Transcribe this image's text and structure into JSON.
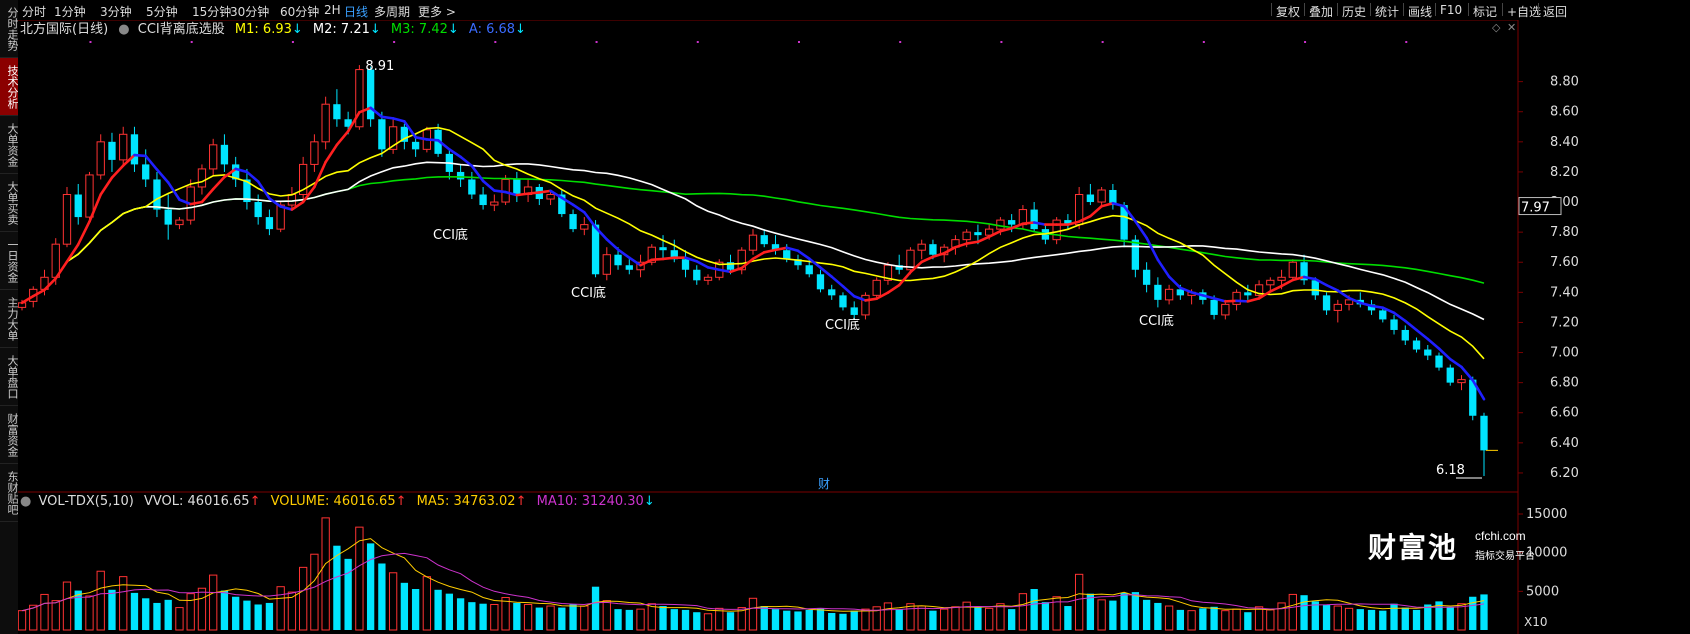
{
  "sidebar": {
    "items": [
      {
        "label": "分时走势",
        "active": false
      },
      {
        "label": "技术分析",
        "active": true
      },
      {
        "label": "大单资金",
        "active": false
      },
      {
        "label": "大单买卖",
        "active": false
      },
      {
        "label": "一日资金",
        "active": false
      },
      {
        "label": "主力大单",
        "active": false
      },
      {
        "label": "大单盘口",
        "active": false
      },
      {
        "label": "财富资金",
        "active": false
      },
      {
        "label": "东财贴吧",
        "active": false
      }
    ]
  },
  "toolbar": {
    "periods": [
      {
        "label": "分时",
        "active": false
      },
      {
        "label": "1分钟",
        "active": false
      },
      {
        "label": "3分钟",
        "active": false
      },
      {
        "label": "5分钟",
        "active": false
      },
      {
        "label": "15分钟",
        "active": false
      },
      {
        "label": "30分钟",
        "active": false
      },
      {
        "label": "60分钟",
        "active": false
      },
      {
        "label": "2H",
        "active": false
      },
      {
        "label": "日线",
        "active": true
      },
      {
        "label": "多周期",
        "active": false
      },
      {
        "label": "更多 >",
        "active": false
      }
    ],
    "right": [
      "复权",
      "叠加",
      "历史",
      "统计",
      "画线",
      "F10",
      "标记",
      "+自选",
      "返回"
    ]
  },
  "price_panel": {
    "stock": "北方国际(日线)",
    "indicator": "CCI背离底选股",
    "m1": "M1: 6.93",
    "m1_arrow": "↓",
    "m2": "M2: 7.21",
    "m2_arrow": "↓",
    "m3": "M3: 7.42",
    "m3_arrow": "↓",
    "a": "A: 6.68",
    "a_arrow": "↓",
    "colors": {
      "m1": "#ffff00",
      "m2": "#ffffff",
      "m3": "#00dd00",
      "a": "#2020ff",
      "up": "#ff3333",
      "down": "#00e5ff"
    }
  },
  "volume_panel": {
    "indicator": "VOL-TDX(5,10)",
    "vvol": "VVOL: 46016.65",
    "vvol_arrow": "↑",
    "volume": "VOLUME: 46016.65",
    "volume_arrow": "↑",
    "ma5": "MA5: 34763.02",
    "ma5_arrow": "↑",
    "ma10": "MA10: 31240.30",
    "ma10_arrow": "↓",
    "unit": "X10"
  },
  "watermark": {
    "main": "财富池",
    "url": "cfchi.com",
    "sub": "指标交易平台"
  },
  "chart_data": {
    "type": "candlestick",
    "price_axis": {
      "ylim": [
        6.1,
        9.05
      ],
      "ticks": [
        "8.80",
        "8.60",
        "8.40",
        "8.20",
        "8.00",
        "7.80",
        "7.60",
        "7.40",
        "7.20",
        "7.00",
        "6.80",
        "6.60",
        "6.40",
        "6.20"
      ],
      "current": "7.97"
    },
    "volume_axis": {
      "ylim": [
        0,
        15000
      ],
      "ticks": [
        "15000",
        "10000",
        "5000"
      ]
    },
    "ohlc": [
      [
        7.3,
        7.35,
        7.28,
        7.33
      ],
      [
        7.34,
        7.44,
        7.3,
        7.42
      ],
      [
        7.42,
        7.55,
        7.38,
        7.5
      ],
      [
        7.5,
        7.76,
        7.45,
        7.72
      ],
      [
        7.72,
        8.1,
        7.7,
        8.05
      ],
      [
        8.05,
        8.12,
        7.85,
        7.9
      ],
      [
        7.9,
        8.2,
        7.88,
        8.18
      ],
      [
        8.18,
        8.45,
        8.15,
        8.4
      ],
      [
        8.4,
        8.46,
        8.2,
        8.28
      ],
      [
        8.28,
        8.5,
        8.25,
        8.45
      ],
      [
        8.45,
        8.5,
        8.2,
        8.25
      ],
      [
        8.25,
        8.35,
        8.1,
        8.15
      ],
      [
        8.15,
        8.2,
        7.9,
        7.95
      ],
      [
        7.95,
        8.05,
        7.75,
        7.85
      ],
      [
        7.85,
        7.9,
        7.82,
        7.88
      ],
      [
        7.88,
        8.15,
        7.85,
        8.1
      ],
      [
        8.1,
        8.25,
        8.05,
        8.22
      ],
      [
        8.22,
        8.42,
        8.18,
        8.38
      ],
      [
        8.38,
        8.45,
        8.2,
        8.25
      ],
      [
        8.25,
        8.3,
        8.1,
        8.15
      ],
      [
        8.15,
        8.22,
        7.95,
        8.0
      ],
      [
        8.0,
        8.05,
        7.85,
        7.9
      ],
      [
        7.9,
        7.95,
        7.78,
        7.82
      ],
      [
        7.82,
        8.0,
        7.8,
        7.98
      ],
      [
        7.98,
        8.1,
        7.95,
        8.05
      ],
      [
        8.05,
        8.3,
        8.0,
        8.25
      ],
      [
        8.25,
        8.45,
        8.2,
        8.4
      ],
      [
        8.4,
        8.7,
        8.35,
        8.65
      ],
      [
        8.65,
        8.75,
        8.5,
        8.55
      ],
      [
        8.55,
        8.6,
        8.45,
        8.5
      ],
      [
        8.5,
        8.91,
        8.48,
        8.88
      ],
      [
        8.88,
        8.9,
        8.5,
        8.55
      ],
      [
        8.55,
        8.6,
        8.3,
        8.35
      ],
      [
        8.35,
        8.55,
        8.32,
        8.5
      ],
      [
        8.5,
        8.52,
        8.35,
        8.4
      ],
      [
        8.4,
        8.45,
        8.3,
        8.35
      ],
      [
        8.35,
        8.5,
        8.33,
        8.48
      ],
      [
        8.48,
        8.52,
        8.3,
        8.32
      ],
      [
        8.32,
        8.35,
        8.15,
        8.2
      ],
      [
        8.2,
        8.25,
        8.1,
        8.15
      ],
      [
        8.15,
        8.2,
        8.02,
        8.05
      ],
      [
        8.05,
        8.1,
        7.95,
        7.98
      ],
      [
        7.98,
        8.05,
        7.94,
        8.0
      ],
      [
        8.0,
        8.18,
        7.98,
        8.15
      ],
      [
        8.15,
        8.2,
        8.0,
        8.05
      ],
      [
        8.05,
        8.15,
        8.0,
        8.1
      ],
      [
        8.1,
        8.12,
        7.98,
        8.02
      ],
      [
        8.02,
        8.08,
        7.98,
        8.05
      ],
      [
        8.05,
        8.08,
        7.9,
        7.92
      ],
      [
        7.92,
        7.95,
        7.8,
        7.82
      ],
      [
        7.82,
        7.9,
        7.78,
        7.85
      ],
      [
        7.85,
        7.88,
        7.5,
        7.52
      ],
      [
        7.52,
        7.7,
        7.48,
        7.65
      ],
      [
        7.65,
        7.7,
        7.55,
        7.58
      ],
      [
        7.58,
        7.62,
        7.52,
        7.55
      ],
      [
        7.55,
        7.65,
        7.5,
        7.6
      ],
      [
        7.6,
        7.72,
        7.58,
        7.7
      ],
      [
        7.7,
        7.78,
        7.62,
        7.68
      ],
      [
        7.68,
        7.75,
        7.6,
        7.62
      ],
      [
        7.62,
        7.68,
        7.5,
        7.55
      ],
      [
        7.55,
        7.58,
        7.45,
        7.48
      ],
      [
        7.48,
        7.52,
        7.45,
        7.5
      ],
      [
        7.5,
        7.62,
        7.48,
        7.6
      ],
      [
        7.6,
        7.65,
        7.52,
        7.55
      ],
      [
        7.55,
        7.7,
        7.52,
        7.68
      ],
      [
        7.68,
        7.82,
        7.65,
        7.78
      ],
      [
        7.78,
        7.82,
        7.7,
        7.72
      ],
      [
        7.72,
        7.78,
        7.65,
        7.68
      ],
      [
        7.68,
        7.72,
        7.6,
        7.62
      ],
      [
        7.62,
        7.65,
        7.55,
        7.58
      ],
      [
        7.58,
        7.62,
        7.5,
        7.52
      ],
      [
        7.52,
        7.55,
        7.4,
        7.42
      ],
      [
        7.42,
        7.45,
        7.35,
        7.38
      ],
      [
        7.38,
        7.4,
        7.28,
        7.3
      ],
      [
        7.3,
        7.34,
        7.22,
        7.25
      ],
      [
        7.25,
        7.4,
        7.22,
        7.38
      ],
      [
        7.38,
        7.5,
        7.35,
        7.48
      ],
      [
        7.48,
        7.6,
        7.45,
        7.58
      ],
      [
        7.58,
        7.65,
        7.52,
        7.55
      ],
      [
        7.55,
        7.7,
        7.52,
        7.68
      ],
      [
        7.68,
        7.75,
        7.62,
        7.72
      ],
      [
        7.72,
        7.75,
        7.62,
        7.65
      ],
      [
        7.65,
        7.72,
        7.6,
        7.7
      ],
      [
        7.7,
        7.78,
        7.65,
        7.75
      ],
      [
        7.75,
        7.82,
        7.7,
        7.8
      ],
      [
        7.8,
        7.85,
        7.72,
        7.78
      ],
      [
        7.78,
        7.85,
        7.75,
        7.82
      ],
      [
        7.82,
        7.9,
        7.78,
        7.88
      ],
      [
        7.88,
        7.92,
        7.8,
        7.85
      ],
      [
        7.85,
        7.98,
        7.82,
        7.95
      ],
      [
        7.95,
        8.0,
        7.8,
        7.82
      ],
      [
        7.82,
        7.85,
        7.72,
        7.75
      ],
      [
        7.75,
        7.9,
        7.72,
        7.88
      ],
      [
        7.88,
        7.92,
        7.82,
        7.85
      ],
      [
        7.85,
        8.1,
        7.82,
        8.05
      ],
      [
        8.05,
        8.12,
        7.98,
        8.0
      ],
      [
        8.0,
        8.1,
        7.98,
        8.08
      ],
      [
        8.08,
        8.12,
        7.95,
        7.98
      ],
      [
        7.98,
        8.0,
        7.7,
        7.75
      ],
      [
        7.75,
        7.78,
        7.5,
        7.55
      ],
      [
        7.55,
        7.6,
        7.4,
        7.45
      ],
      [
        7.45,
        7.5,
        7.3,
        7.35
      ],
      [
        7.35,
        7.45,
        7.32,
        7.42
      ],
      [
        7.42,
        7.45,
        7.35,
        7.38
      ],
      [
        7.38,
        7.42,
        7.32,
        7.4
      ],
      [
        7.4,
        7.42,
        7.32,
        7.35
      ],
      [
        7.35,
        7.38,
        7.22,
        7.25
      ],
      [
        7.25,
        7.35,
        7.22,
        7.32
      ],
      [
        7.32,
        7.42,
        7.28,
        7.4
      ],
      [
        7.4,
        7.45,
        7.35,
        7.38
      ],
      [
        7.38,
        7.48,
        7.35,
        7.45
      ],
      [
        7.45,
        7.5,
        7.4,
        7.48
      ],
      [
        7.48,
        7.55,
        7.42,
        7.5
      ],
      [
        7.5,
        7.62,
        7.48,
        7.6
      ],
      [
        7.6,
        7.65,
        7.45,
        7.48
      ],
      [
        7.48,
        7.5,
        7.35,
        7.38
      ],
      [
        7.38,
        7.4,
        7.25,
        7.28
      ],
      [
        7.28,
        7.35,
        7.2,
        7.32
      ],
      [
        7.32,
        7.38,
        7.28,
        7.35
      ],
      [
        7.35,
        7.4,
        7.3,
        7.32
      ],
      [
        7.32,
        7.35,
        7.25,
        7.28
      ],
      [
        7.28,
        7.3,
        7.2,
        7.22
      ],
      [
        7.22,
        7.25,
        7.12,
        7.15
      ],
      [
        7.15,
        7.18,
        7.05,
        7.08
      ],
      [
        7.08,
        7.1,
        7.0,
        7.02
      ],
      [
        7.02,
        7.05,
        6.95,
        6.98
      ],
      [
        6.98,
        7.0,
        6.88,
        6.9
      ],
      [
        6.9,
        6.92,
        6.78,
        6.8
      ],
      [
        6.8,
        6.85,
        6.75,
        6.82
      ],
      [
        6.82,
        6.84,
        6.55,
        6.58
      ],
      [
        6.58,
        6.6,
        6.18,
        6.35
      ]
    ],
    "volume": [
      2500,
      3200,
      4600,
      3800,
      6200,
      5100,
      4400,
      7600,
      5200,
      6900,
      4800,
      4100,
      3500,
      3900,
      2900,
      4700,
      5400,
      7100,
      5100,
      4300,
      3800,
      3300,
      3500,
      5600,
      4900,
      8100,
      9800,
      14500,
      10900,
      9200,
      13300,
      11200,
      8600,
      7400,
      6100,
      5300,
      6900,
      5200,
      4700,
      4100,
      3600,
      3400,
      3300,
      4200,
      3500,
      3300,
      2900,
      3100,
      2900,
      3300,
      3100,
      5600,
      3800,
      2700,
      2600,
      2700,
      3400,
      3100,
      2700,
      2600,
      2300,
      2100,
      2800,
      2300,
      2900,
      4100,
      3100,
      2700,
      2500,
      2400,
      2600,
      2800,
      2200,
      2100,
      2500,
      2700,
      3000,
      3500,
      2700,
      3400,
      3100,
      2500,
      2700,
      3000,
      3600,
      2900,
      2800,
      3400,
      2700,
      4700,
      5300,
      3600,
      4300,
      3100,
      7200,
      4700,
      3900,
      3800,
      4800,
      4900,
      3900,
      3500,
      3100,
      2600,
      2500,
      2800,
      3000,
      2500,
      2700,
      2300,
      3000,
      2600,
      3500,
      4600,
      4500,
      3700,
      3300,
      3100,
      2800,
      2700,
      2600,
      2500,
      3400,
      2900,
      2600,
      3300,
      3700,
      3000,
      3400,
      4300,
      4602
    ],
    "ma_colors": {
      "m1": "#ffff00",
      "m2": "#ffffff",
      "m3": "#00dd00",
      "a": "#2020ff"
    },
    "annotations": [
      "CCI底",
      "CCI底",
      "CCI底",
      "CCI底"
    ],
    "marks": [
      "8.91",
      "6.18",
      "财"
    ]
  }
}
